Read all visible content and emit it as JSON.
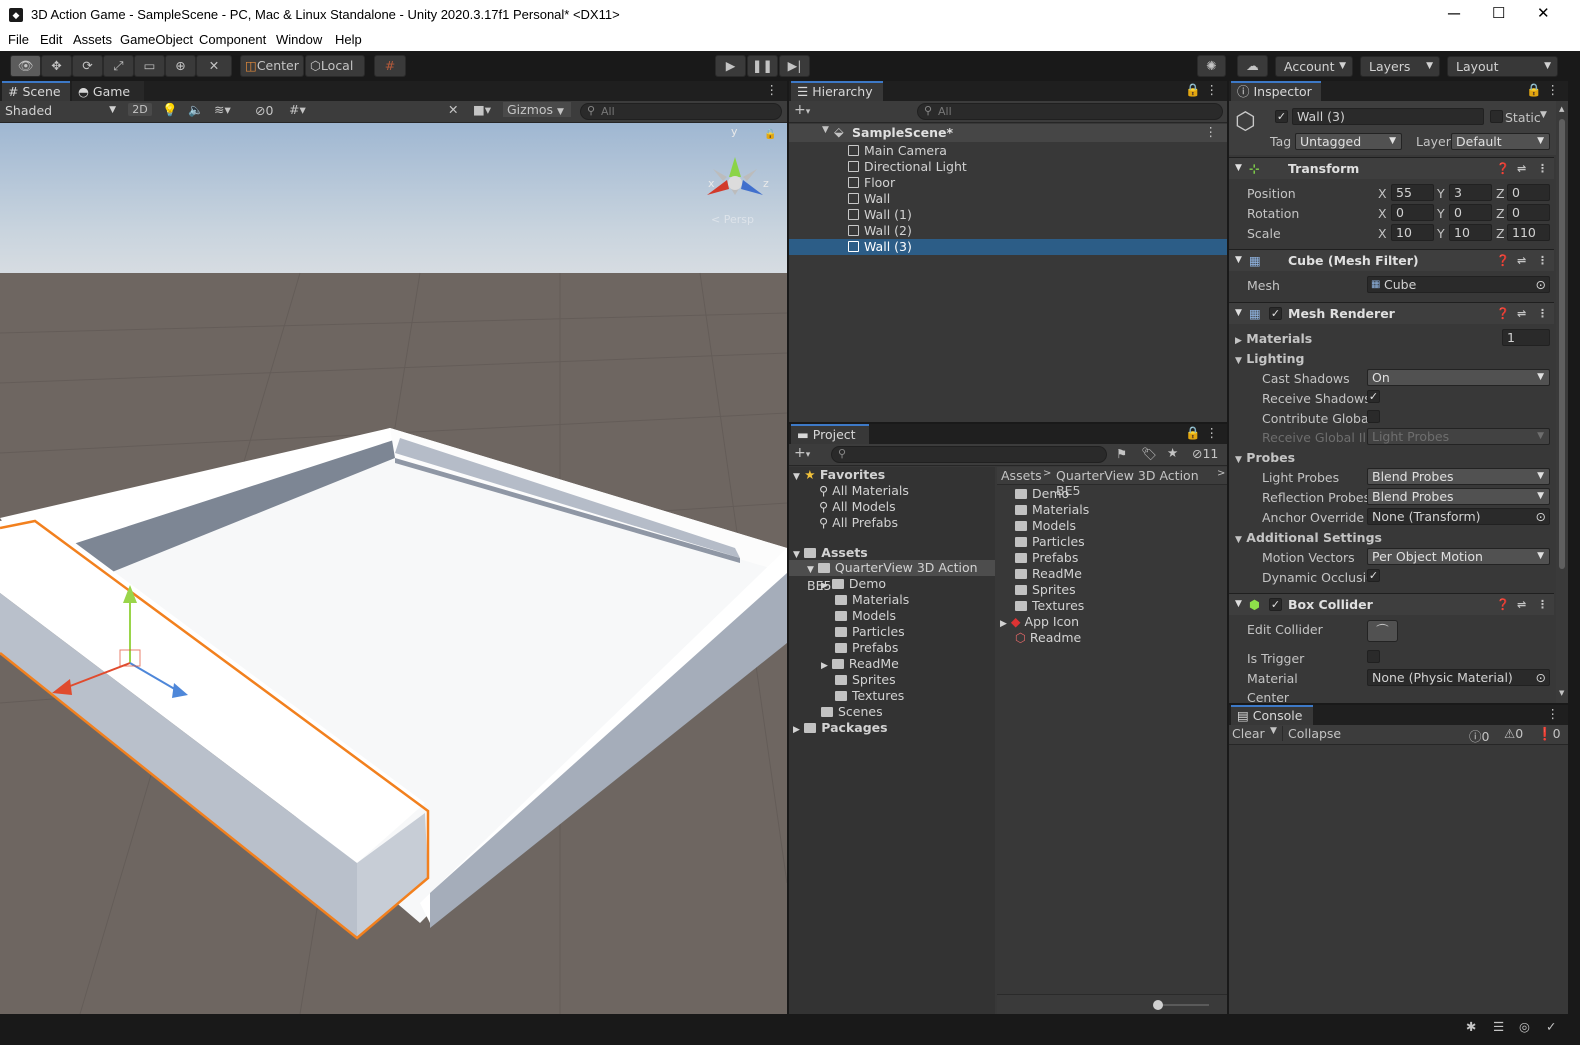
{
  "window": {
    "title": "3D Action Game - SampleScene - PC, Mac & Linux Standalone - Unity 2020.3.17f1 Personal* <DX11>",
    "app_icon": "unity-icon",
    "minimize": "─",
    "maximize": "☐",
    "close": "✕"
  },
  "menu": [
    "File",
    "Edit",
    "Assets",
    "GameObject",
    "Component",
    "Window",
    "Help"
  ],
  "toolbar": {
    "center": "Center",
    "local": "Local",
    "account": "Account",
    "layers": "Layers",
    "layout": "Layout"
  },
  "scene": {
    "tab_scene": "Scene",
    "tab_game": "Game",
    "shading": "Shaded",
    "mode_2d": "2D",
    "hidden_count": "0",
    "gizmos": "Gizmos",
    "search_placeholder": "All",
    "persp": "< Persp",
    "axis_y": "y",
    "axis_x": "x",
    "axis_z": "z"
  },
  "hierarchy": {
    "title": "Hierarchy",
    "search_placeholder": "All",
    "scene_name": "SampleScene*",
    "items": [
      "Main Camera",
      "Directional Light",
      "Floor",
      "Wall",
      "Wall (1)",
      "Wall (2)",
      "Wall (3)"
    ],
    "selected": "Wall (3)"
  },
  "project": {
    "title": "Project",
    "hidden_count": "11",
    "favorites": "Favorites",
    "fav_items": [
      "All Materials",
      "All Models",
      "All Prefabs"
    ],
    "assets": "Assets",
    "root_folder": "QuarterView 3D Action BE5",
    "subfolders": [
      "Demo",
      "Materials",
      "Models",
      "Particles",
      "Prefabs",
      "ReadMe",
      "Sprites",
      "Textures"
    ],
    "scenes": "Scenes",
    "packages": "Packages",
    "breadcrumb": [
      "Assets",
      "QuarterView 3D Action BE5"
    ],
    "content": [
      "Demo",
      "Materials",
      "Models",
      "Particles",
      "Prefabs",
      "ReadMe",
      "Sprites",
      "Textures"
    ],
    "content_files": [
      "App Icon",
      "Readme"
    ]
  },
  "inspector": {
    "title": "Inspector",
    "object_name": "Wall (3)",
    "static": "Static",
    "tag_label": "Tag",
    "tag": "Untagged",
    "layer_label": "Layer",
    "layer": "Default",
    "transform": {
      "title": "Transform",
      "position_label": "Position",
      "rotation_label": "Rotation",
      "scale_label": "Scale",
      "position": [
        "55",
        "3",
        "0"
      ],
      "rotation": [
        "0",
        "0",
        "0"
      ],
      "scale": [
        "10",
        "10",
        "110"
      ]
    },
    "mesh_filter": {
      "title": "Cube (Mesh Filter)",
      "mesh_label": "Mesh",
      "mesh": "Cube"
    },
    "mesh_renderer": {
      "title": "Mesh Renderer",
      "materials": "Materials",
      "materials_count": "1",
      "lighting": "Lighting",
      "cast_shadows_label": "Cast Shadows",
      "cast_shadows": "On",
      "receive_shadows": "Receive Shadows",
      "contribute_gi": "Contribute Global I",
      "receive_gi_label": "Receive Global Illu",
      "receive_gi": "Light Probes",
      "probes": "Probes",
      "light_probes_label": "Light Probes",
      "light_probes": "Blend Probes",
      "reflection_probes_label": "Reflection Probes",
      "reflection_probes": "Blend Probes",
      "anchor_override_label": "Anchor Override",
      "anchor_override": "None (Transform)",
      "additional": "Additional Settings",
      "motion_vectors_label": "Motion Vectors",
      "motion_vectors": "Per Object Motion",
      "dynamic_occlusion": "Dynamic Occlusio"
    },
    "box_collider": {
      "title": "Box Collider",
      "edit_collider": "Edit Collider",
      "is_trigger": "Is Trigger",
      "material_label": "Material",
      "material": "None (Physic Material)",
      "center": "Center"
    }
  },
  "console": {
    "title": "Console",
    "clear": "Clear",
    "collapse": "Collapse",
    "logs": "0",
    "warnings": "0",
    "errors": "0"
  }
}
